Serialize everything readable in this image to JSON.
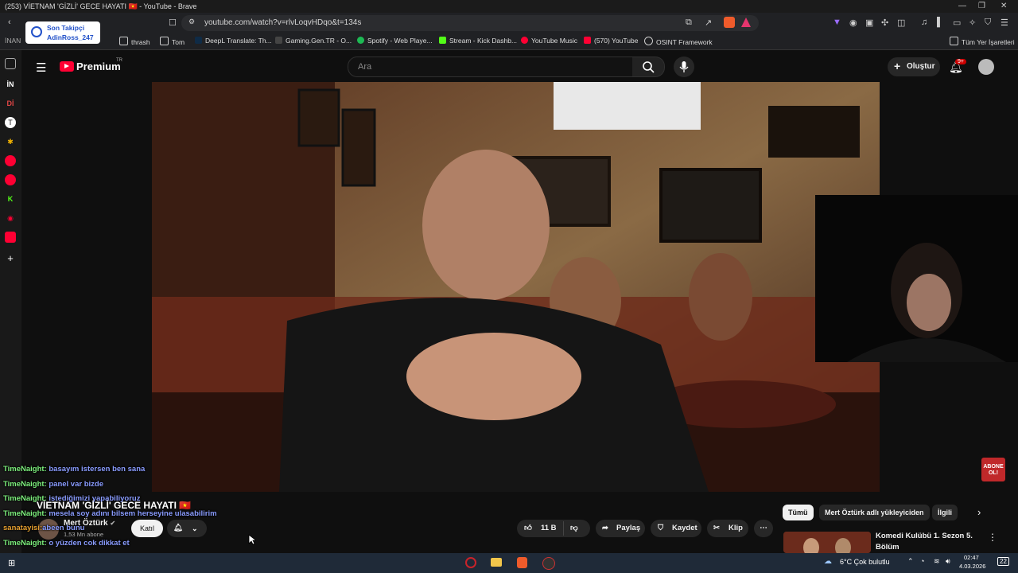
{
  "window": {
    "title": "(253) VİETNAM 'GİZLİ' GECE HAYATI 🇻🇳 - YouTube - Brave"
  },
  "browser": {
    "url": "youtube.com/watch?v=rlvLoqvHDqo&t=134s",
    "bookmarks": [
      {
        "label": "thrash",
        "icon": "folder-icon"
      },
      {
        "label": "Tom",
        "icon": "folder-icon"
      },
      {
        "label": "DeepL Translate: Th...",
        "icon": "deepl-icon"
      },
      {
        "label": "Gaming.Gen.TR - O...",
        "icon": "gaming-icon"
      },
      {
        "label": "Spotify - Web Playe...",
        "icon": "spotify-icon"
      },
      {
        "label": "Stream - Kick Dashb...",
        "icon": "kick-icon"
      },
      {
        "label": "YouTube Music",
        "icon": "youtube-music-icon"
      },
      {
        "label": "(570) YouTube",
        "icon": "youtube-icon"
      },
      {
        "label": "OSINT Framework",
        "icon": "osint-icon"
      }
    ],
    "all_bookmarks": "Tüm Yer İşaretleri",
    "left_fragment": "İNAN"
  },
  "follower_widget": {
    "title": "Son Takipçi",
    "name": "AdinRoss_247"
  },
  "sidebar": {
    "items": [
      "İN",
      "Dİ"
    ]
  },
  "youtube": {
    "logo": "Premium",
    "region": "TR",
    "search_placeholder": "Ara",
    "create_label": "Oluştur",
    "notification_count": "9+"
  },
  "chat": [
    {
      "user": "TimeNaight:",
      "message": "basayım istersen ben sana"
    },
    {
      "user": "TimeNaight:",
      "message": "panel var bizde"
    },
    {
      "user": "TimeNaight:",
      "message": "istediğimizi yapabiliyoruz"
    },
    {
      "user": "TimeNaight:",
      "message": "mesela soy adını bilsem herseyine ulasabilirim"
    },
    {
      "user": "sanatayisi:",
      "message": "abeen bunu"
    },
    {
      "user": "TimeNaight:",
      "message": "o yüzden cok dikkat et"
    }
  ],
  "video": {
    "title": "VİETNAM 'GİZLİ' GECE HAYATI 🇻🇳",
    "channel": "Mert Öztürk",
    "subscribers": "1,53 Mn abone",
    "join_label": "Katıl",
    "likes": "11 B",
    "share_label": "Paylaş",
    "save_label": "Kaydet",
    "clip_label": "Klip",
    "subscribe_overlay": "ABONE OL!"
  },
  "filters": {
    "chips": [
      "Tümü",
      "Mert Öztürk adlı yükleyiciden",
      "İlgili"
    ]
  },
  "recommended": {
    "title_line1": "Komedi Kulübü 1. Sezon 5.",
    "title_line2": "Bölüm"
  },
  "taskbar": {
    "weather": "6°C  Çok bulutlu",
    "time": "02:47",
    "date": "4.03.2026",
    "notification_count": "22"
  },
  "colors": {
    "youtube_red": "#ff0033",
    "chat_user": "#7df07d",
    "chat_message": "#8a9cff"
  }
}
